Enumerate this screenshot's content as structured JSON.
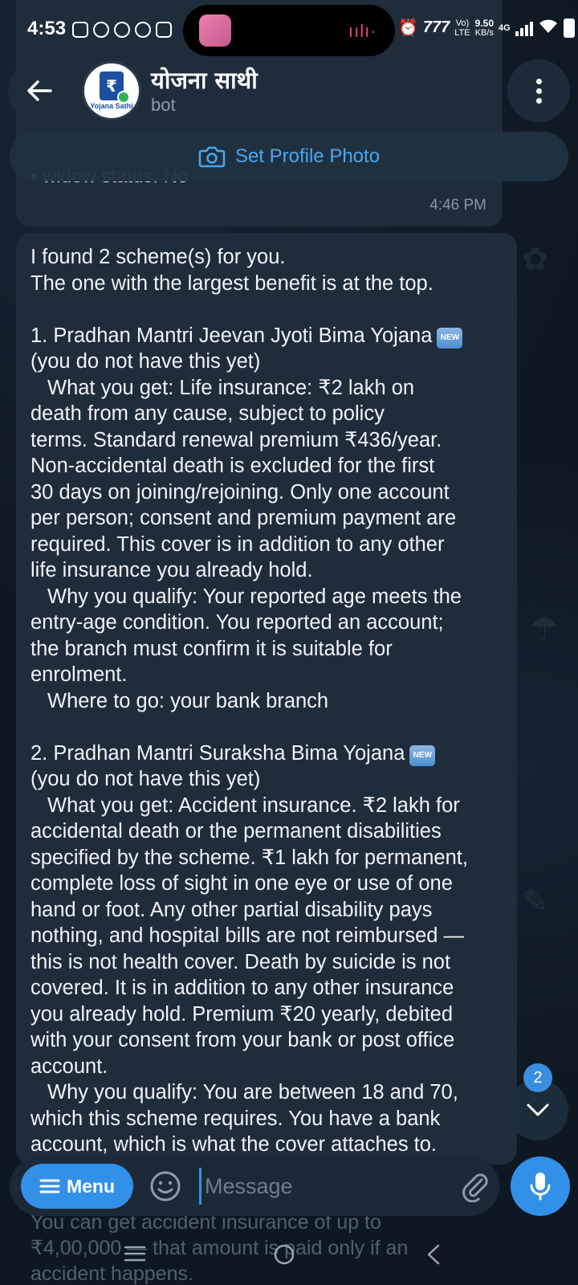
{
  "status_bar": {
    "time": "4:53",
    "net_speed_value": "9.50",
    "net_speed_unit": "KB/s",
    "volte_top": "Vo)",
    "volte_bottom": "LTE",
    "network_type": "4G"
  },
  "header": {
    "title": "योजना साथी",
    "subtitle": "bot",
    "avatar_mark": "₹",
    "avatar_text": "Yojana Sathi",
    "set_photo_label": "Set Profile Photo"
  },
  "previous_message": {
    "visible_lines": [
      "• widow status: No"
    ],
    "time": "4:46 PM"
  },
  "message": {
    "intro": [
      "I found 2 scheme(s) for you.",
      "The one with the largest benefit is at the top."
    ],
    "new_badge": "NEW",
    "scheme1": {
      "title": "1. Pradhan Mantri Jeevan Jyoti Bima Yojana",
      "status": "(you do not have this yet)",
      "what_lines": [
        "What you get: Life insurance: ₹2 lakh on",
        "death from any cause, subject to policy",
        "terms. Standard renewal premium ₹436/year.",
        "Non-accidental death is excluded for the first",
        "30 days on joining/rejoining. Only one account",
        "per person; consent and premium payment are",
        "required. This cover is in addition to any other",
        "life insurance you already hold."
      ],
      "why_lines": [
        "Why you qualify: Your reported age meets the",
        "entry-age condition. You reported an account;",
        "the branch must confirm it is suitable for",
        "enrolment."
      ],
      "where": "Where to go: your bank branch"
    },
    "scheme2": {
      "title": "2. Pradhan Mantri Suraksha Bima Yojana",
      "status": "(you do not have this yet)",
      "what_lines": [
        "What you get: Accident insurance. ₹2 lakh for",
        "accidental death or the permanent disabilities",
        "specified by the scheme. ₹1 lakh for permanent,",
        "complete loss of sight in one eye or use of one",
        "hand or foot. Any other partial disability pays",
        "nothing, and hospital bills are not reimbursed —",
        "this is not health cover. Death by suicide is not",
        "covered. It is in addition to any other insurance",
        "you already hold. Premium ₹20 yearly, debited",
        "with your consent from your bank or post office",
        "account."
      ],
      "why_lines": [
        "Why you qualify: You are between 18 and 70,",
        "which this scheme requires. You have a bank",
        "account, which is what the cover attaches to."
      ]
    }
  },
  "scroll": {
    "unread_count": "2"
  },
  "composer": {
    "menu_label": "Menu",
    "placeholder": "Message"
  },
  "under_text": [
    "You can get accident insurance of up to",
    "₹4,00,000 — that amount is paid only if an",
    "accident happens."
  ],
  "colors": {
    "accent": "#3390e8",
    "bubble": "#1f2c3a",
    "background": "#0e1823"
  }
}
